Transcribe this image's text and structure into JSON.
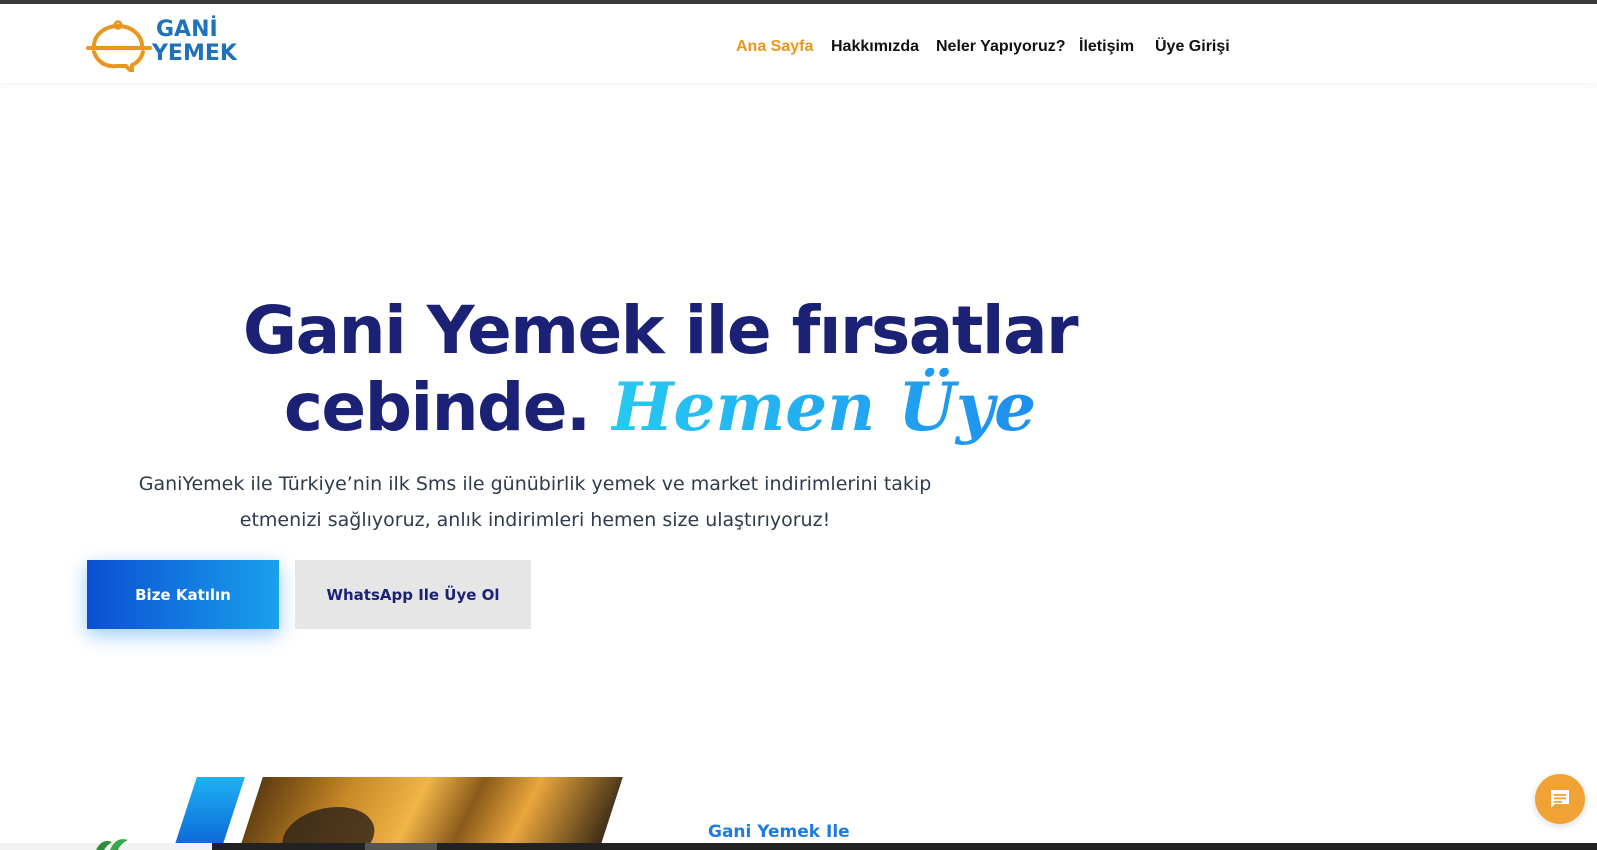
{
  "brand": {
    "name_line1": "GANİ",
    "name_line2": "YEMEK",
    "primary_color": "#1e72bb",
    "accent_color": "#e9961f"
  },
  "nav": {
    "items": [
      {
        "label": "Ana Sayfa",
        "active": true
      },
      {
        "label": "Hakkımızda",
        "active": false
      },
      {
        "label": "Neler Yapıyoruz?",
        "active": false
      },
      {
        "label": "İletişim",
        "active": false
      },
      {
        "label": "Üye Girişi",
        "active": false
      }
    ]
  },
  "hero": {
    "title_line1": "Gani Yemek ile fırsatlar",
    "title_line2": "cebinde.",
    "title_accent": "Hemen Üye",
    "subtitle_line1": "GaniYemek ile Türkiye’nin ilk Sms ile günübirlik yemek ve market indirimlerini takip",
    "subtitle_line2": "etmenizi sağlıyoruz, anlık indirimleri hemen size ulaştırıyoruz!",
    "primary_button": "Bize Katılın",
    "secondary_button": "WhatsApp Ile Üye Ol"
  },
  "about": {
    "label": "Gani Yemek Ile"
  },
  "icons": {
    "logo": "food-cloche-icon",
    "chat": "chat-bubble-icon",
    "leaf": "leaf-icon"
  }
}
